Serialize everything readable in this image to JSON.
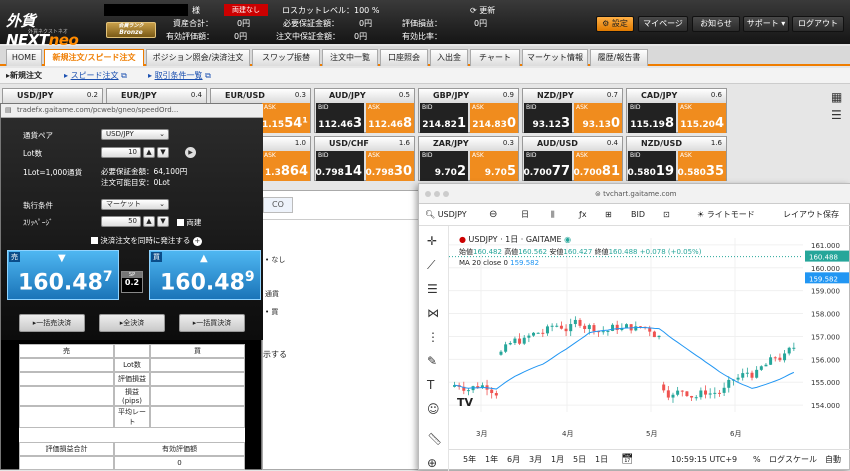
{
  "header": {
    "logo_prefix": "外貨",
    "logo_main": "NEXT",
    "logo_accent": "neo",
    "logo_sub": "外貨ネクストネオ",
    "badge_rank": "会員ランク",
    "badge_name": "Bronze",
    "account_suffix": "様",
    "status": "両建なし",
    "losscut_label": "ロスカットレベル：",
    "losscut_value": "100 %",
    "refresh": "更新",
    "total_assets_label": "資産合計：",
    "total_assets_value": "0円",
    "required_margin_label": "必要保証金額：",
    "required_margin_value": "0円",
    "valuation_pl_label": "評価損益：",
    "valuation_pl_value": "0円",
    "effective_valuation_label": "有効評価額：",
    "effective_valuation_value": "0円",
    "pending_margin_label": "注文中保証金額：",
    "pending_margin_value": "0円",
    "effective_ratio_label": "有効比率：",
    "effective_ratio_value": "",
    "settings": "設定",
    "mypage": "マイページ",
    "notice": "お知らせ",
    "support": "サポート",
    "logout": "ログアウト"
  },
  "nav": {
    "tabs": [
      "HOME",
      "新規注文/スピード注文",
      "ポジション照会/決済注文",
      "スワップ振替",
      "注文中一覧",
      "口座照会",
      "入出金",
      "チャート",
      "マーケット情報",
      "履歴/報告書"
    ],
    "sub": [
      "新規注文",
      "スピード注文",
      "取引条件一覧"
    ]
  },
  "tiles": [
    {
      "pair": "USD/JPY",
      "spread": "0.2",
      "bid_main": "",
      "bid_big": "",
      "ask_main": "",
      "ask_big": ""
    },
    {
      "pair": "EUR/JPY",
      "spread": "0.4",
      "bid_main": "",
      "bid_big": "",
      "ask_main": "",
      "ask_big": ""
    },
    {
      "pair": "EUR/USD",
      "spread": "0.3",
      "bid_main": "",
      "bid_big": "",
      "ask_main": "1.15",
      "ask_big": "54¹"
    },
    {
      "pair": "AUD/JPY",
      "spread": "0.5",
      "bid_main": "112.46",
      "bid_big": "3",
      "ask_main": "112.46",
      "ask_big": "8"
    },
    {
      "pair": "GBP/JPY",
      "spread": "0.9",
      "bid_main": "214.82",
      "bid_big": "1",
      "ask_main": "214.83",
      "ask_big": "0"
    },
    {
      "pair": "NZD/JPY",
      "spread": "0.7",
      "bid_main": "93.12",
      "bid_big": "3",
      "ask_main": "93.13",
      "ask_big": "0"
    },
    {
      "pair": "CAD/JPY",
      "spread": "0.6",
      "bid_main": "115.19",
      "bid_big": "8",
      "ask_main": "115.20",
      "ask_big": "4"
    },
    {
      "pair": "",
      "spread": "1.0",
      "bid_main": "",
      "bid_big": "",
      "ask_main": "1.3",
      "ask_big": "864"
    },
    {
      "pair": "USD/CHF",
      "spread": "1.6",
      "bid_main": "0.798",
      "bid_big": "14",
      "ask_main": "0.798",
      "ask_big": "30"
    },
    {
      "pair": "ZAR/JPY",
      "spread": "0.3",
      "bid_main": "9.70",
      "bid_big": "2",
      "ask_main": "9.70",
      "ask_big": "5"
    },
    {
      "pair": "AUD/USD",
      "spread": "0.4",
      "bid_main": "0.700",
      "bid_big": "77",
      "ask_main": "0.700",
      "ask_big": "81"
    },
    {
      "pair": "NZD/USD",
      "spread": "1.6",
      "bid_main": "0.580",
      "bid_big": "19",
      "ask_main": "0.580",
      "ask_big": "35"
    }
  ],
  "tile_labels": {
    "bid": "BID",
    "ask": "ASK"
  },
  "popup": {
    "url": "tradefx.gaitame.com/pcweb/gneo/speedOrd...",
    "currency_label": "通貨ペア",
    "currency_value": "USD/JPY",
    "lot_label": "Lot数",
    "lot_value": "10",
    "lot_unit_label": "1Lot=1,000通貨",
    "required_margin": "必要保証金額：64,100円",
    "possible_lot": "注文可能目安：0Lot",
    "exec_label": "執行条件",
    "exec_value": "マーケット",
    "slippage_label": "ｽﾘｯﾍﾟｰｼﾞ",
    "slippage_value": "50",
    "hedge_label": "両建",
    "settle_same_label": "決済注文を同時に発注する",
    "sell_label": "売",
    "buy_label": "買",
    "sell_price_main": "160.48",
    "sell_price_pip": "7",
    "buy_price_main": "160.48",
    "buy_price_pip": "9",
    "sp_label": "SP",
    "sp_value": "0.2",
    "settle_sell": "一括売決済",
    "settle_all": "全決済",
    "settle_buy": "一括買決済",
    "table": {
      "col_sell": "売",
      "col_buy": "買",
      "rows": [
        "Lot数",
        "評価損益",
        "損益 (pips)",
        "平均レート"
      ],
      "total_pl": "評価損益合計",
      "effective": "有効評価額",
      "effective_value": "0"
    }
  },
  "middle": {
    "tab": "CO",
    "row_none": "なし",
    "row_rate": "通貨",
    "row_buy": "買",
    "row_send": "示する"
  },
  "chart": {
    "url": "tvchart.gaitame.com",
    "symbol": "USDJPY",
    "interval": "日",
    "bid": "BID",
    "light_mode": "ライトモード",
    "save_layout": "レイアウト保存",
    "legend_title": "USDJPY · 1日 · GAITAME",
    "open_label": "始値",
    "open": "160.482",
    "high_label": "高値",
    "high": "160.562",
    "low_label": "安値",
    "low": "160.427",
    "close_label": "終値",
    "close": "160.488",
    "change": "+0.078 (+0.05%)",
    "ma_label": "MA 20 close 0",
    "ma_value": "159.582",
    "last_price_tag": "160.488",
    "ma_price_tag": "159.582",
    "y_ticks": [
      "161.000",
      "160.000",
      "159.000",
      "158.000",
      "157.000",
      "156.000",
      "155.000",
      "154.000"
    ],
    "x_ticks": [
      "3月",
      "4月",
      "5月",
      "6月"
    ],
    "ranges": [
      "5年",
      "1年",
      "6月",
      "3月",
      "1月",
      "5日",
      "1日"
    ],
    "time": "10:59:15 UTC+9",
    "pct": "%",
    "log": "ログスケール",
    "auto": "自動",
    "colors": {
      "up": "#26a69a",
      "down": "#ef5350",
      "ma": "#2196f3"
    }
  }
}
